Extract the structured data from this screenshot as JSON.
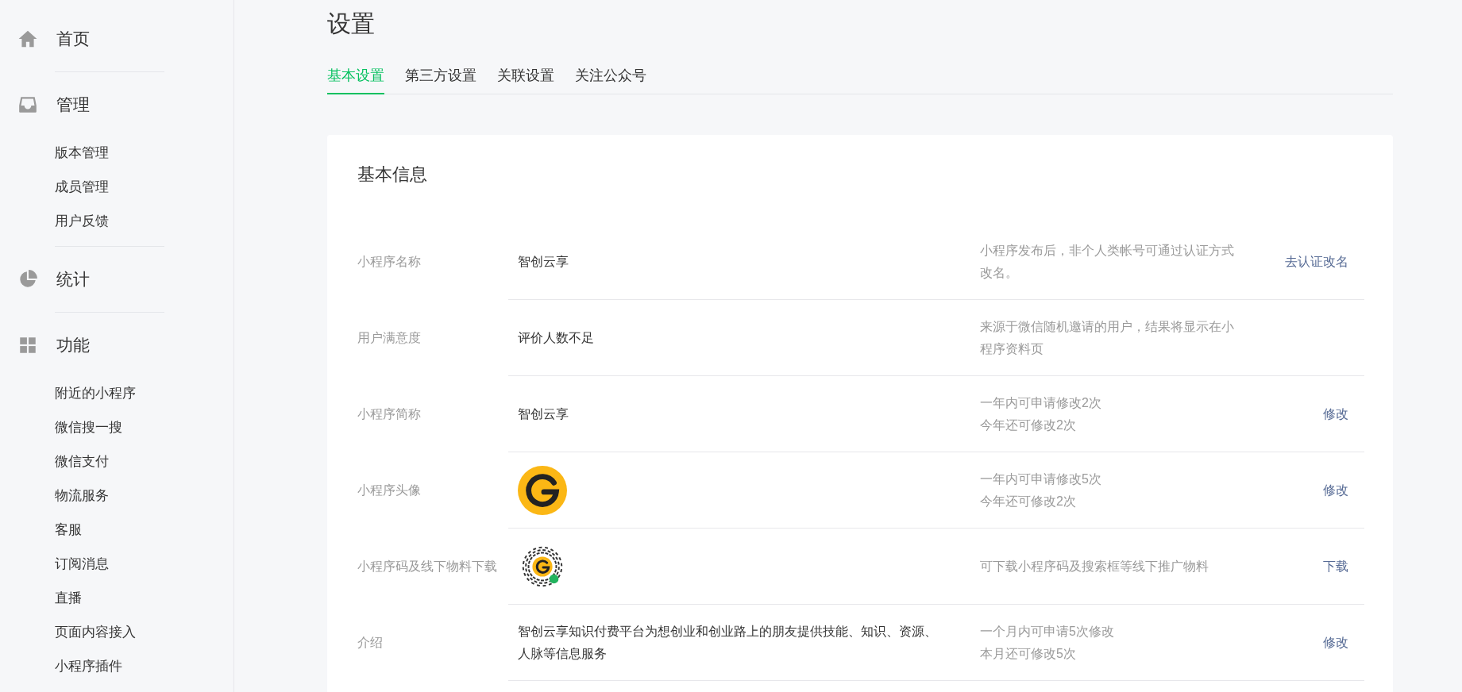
{
  "sidebar": {
    "sections": [
      {
        "title": "首页"
      },
      {
        "title": "管理",
        "children": [
          {
            "label": "版本管理"
          },
          {
            "label": "成员管理"
          },
          {
            "label": "用户反馈"
          }
        ]
      },
      {
        "title": "统计"
      },
      {
        "title": "功能",
        "children": [
          {
            "label": "附近的小程序"
          },
          {
            "label": "微信搜一搜"
          },
          {
            "label": "微信支付"
          },
          {
            "label": "物流服务"
          },
          {
            "label": "客服"
          },
          {
            "label": "订阅消息"
          },
          {
            "label": "直播"
          },
          {
            "label": "页面内容接入"
          },
          {
            "label": "小程序插件"
          }
        ]
      }
    ]
  },
  "page": {
    "title": "设置"
  },
  "tabs": [
    {
      "label": "基本设置",
      "selected": true
    },
    {
      "label": "第三方设置",
      "selected": false
    },
    {
      "label": "关联设置",
      "selected": false
    },
    {
      "label": "关注公众号",
      "selected": false
    }
  ],
  "card": {
    "title": "基本信息",
    "rows": [
      {
        "label": "小程序名称",
        "kind": "text",
        "value": "智创云享",
        "description": [
          "小程序发布后，非个人类帐号可通过认证方式改名。"
        ],
        "action": "去认证改名"
      },
      {
        "label": "用户满意度",
        "kind": "text",
        "value": "评价人数不足",
        "description": [
          "来源于微信随机邀请的用户，结果将显示在小程序资料页"
        ]
      },
      {
        "label": "小程序简称",
        "kind": "text",
        "value": "智创云享",
        "description": [
          "一年内可申请修改2次",
          "今年还可修改2次"
        ],
        "action": "修改"
      },
      {
        "label": "小程序头像",
        "kind": "avatar",
        "description": [
          "一年内可申请修改5次",
          "今年还可修改2次"
        ],
        "action": "修改"
      },
      {
        "label": "小程序码及线下物料下载",
        "kind": "code",
        "description": [
          "可下载小程序码及搜索框等线下推广物料"
        ],
        "action": "下载"
      },
      {
        "label": "介绍",
        "kind": "text",
        "value": "智创云享知识付费平台为想创业和创业路上的朋友提供技能、知识、资源、人脉等信息服务",
        "description": [
          "一个月内可申请5次修改",
          "本月还可修改5次"
        ],
        "action": "修改"
      }
    ]
  }
}
